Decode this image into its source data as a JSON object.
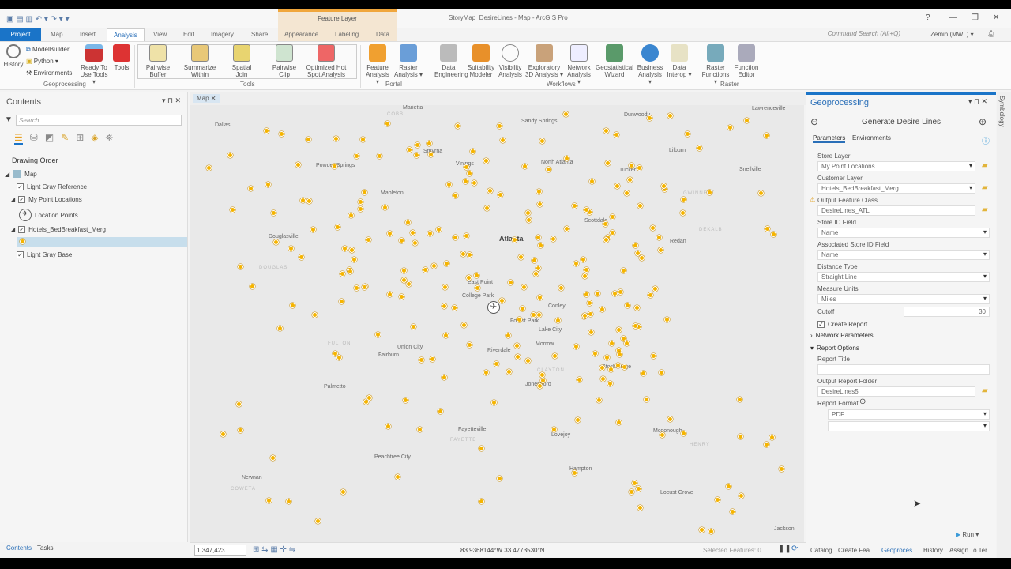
{
  "window": {
    "title": "StoryMap_DesireLines - Map - ArcGIS Pro",
    "context_tab": "Feature Layer",
    "help": "?",
    "minimize": "—",
    "restore": "❐",
    "close": "✕"
  },
  "tabs": [
    "Project",
    "Map",
    "Insert",
    "Analysis",
    "View",
    "Edit",
    "Imagery",
    "Share",
    "Appearance",
    "Labeling",
    "Data"
  ],
  "command_search": "Command Search (Alt+Q)",
  "user": "Zemin (MWL) ▾",
  "ribbon": {
    "geoprocessing": {
      "history": "History",
      "modelbuilder": "ModelBuilder",
      "python": "Python ▾",
      "environments": "Environments",
      "ready": "Ready To Use Tools ▾",
      "tools": "Tools",
      "group": "Geoprocessing"
    },
    "tools": {
      "items": [
        "Pairwise Buffer",
        "Summarize Within",
        "Spatial Join",
        "Pairwise Clip",
        "Optimized Hot Spot Analysis"
      ],
      "group": "Tools"
    },
    "portal": {
      "items": [
        "Feature Analysis ▾",
        "Raster Analysis ▾"
      ],
      "group": "Portal"
    },
    "workflows": {
      "items": [
        "Data Engineering",
        "Suitability Modeler",
        "Visibility Analysis",
        "Exploratory 3D Analysis ▾",
        "Network Analysis ▾",
        "Geostatistical Wizard",
        "Business Analysis ▾",
        "Data Interop ▾"
      ],
      "group": "Workflows"
    },
    "raster": {
      "items": [
        "Raster Functions ▾",
        "Function Editor"
      ],
      "group": "Raster"
    }
  },
  "contents": {
    "title": "Contents",
    "search_placeholder": "Search",
    "heading": "Drawing Order",
    "layers": {
      "map": "Map",
      "ref": "Light Gray Reference",
      "points": "My Point Locations",
      "points_sym": "Location Points",
      "hotels": "Hotels_BedBreakfast_Merg",
      "base": "Light Gray Base"
    },
    "bottom_tabs": [
      "Contents",
      "Tasks"
    ]
  },
  "map": {
    "tab": "Map",
    "scale": "1:347,423",
    "coords": "83.9368144°W 33.4773530°N",
    "selected": "Selected Features: 0",
    "places": [
      "Marietta",
      "Sandy Springs",
      "Dunwoody",
      "Lawrenceville",
      "Dallas",
      "Smyrna",
      "Vinings",
      "North Atlanta",
      "Lilburn",
      "Powder Springs",
      "Tucker",
      "Snellville",
      "Mableton",
      "Douglasville",
      "Atlanta",
      "Scottdale",
      "Redan",
      "East Point",
      "College Park",
      "Conley",
      "Forest Park",
      "Lake City",
      "Union City",
      "Riverdale",
      "Fairburn",
      "Morrow",
      "Stockbridge",
      "Jonesboro",
      "Palmetto",
      "Fayetteville",
      "Lovejoy",
      "Mcdonough",
      "Peachtree City",
      "Hampton",
      "Newnan",
      "Locust Grove",
      "Jackson"
    ],
    "counties": [
      "COBB",
      "GWINNETT",
      "DOUGLAS",
      "DEKALB",
      "FULTON",
      "CLAYTON",
      "HENRY",
      "FAYETTE",
      "COWETA"
    ]
  },
  "gp": {
    "title": "Geoprocessing",
    "tool": "Generate Desire Lines",
    "tab_params": "Parameters",
    "tab_env": "Environments",
    "store_layer_label": "Store Layer",
    "store_layer": "My Point Locations",
    "customer_layer_label": "Customer Layer",
    "customer_layer": "Hotels_BedBreakfast_Merg",
    "output_label": "Output Feature Class",
    "output": "DesireLines_ATL",
    "store_id_label": "Store ID Field",
    "store_id": "Name",
    "assoc_label": "Associated Store ID Field",
    "assoc": "Name",
    "dist_label": "Distance Type",
    "dist": "Straight Line",
    "units_label": "Measure Units",
    "units": "Miles",
    "cutoff_label": "Cutoff",
    "cutoff": "30",
    "create_report": "Create Report",
    "network": "Network Parameters",
    "report_opts": "Report Options",
    "report_title_label": "Report Title",
    "report_title": "",
    "report_folder_label": "Output Report Folder",
    "report_folder": "DesireLines5",
    "report_format_label": "Report Format",
    "report_format": "PDF",
    "run": "Run",
    "bottom_tabs": [
      "Catalog",
      "Create Fea...",
      "Geoproces...",
      "History",
      "Assign To Ter..."
    ],
    "side_tab": "Symbology"
  },
  "colors": {
    "accent": "#1a74c8",
    "dot": "#f5b400",
    "ctx": "#f4e6d2"
  }
}
